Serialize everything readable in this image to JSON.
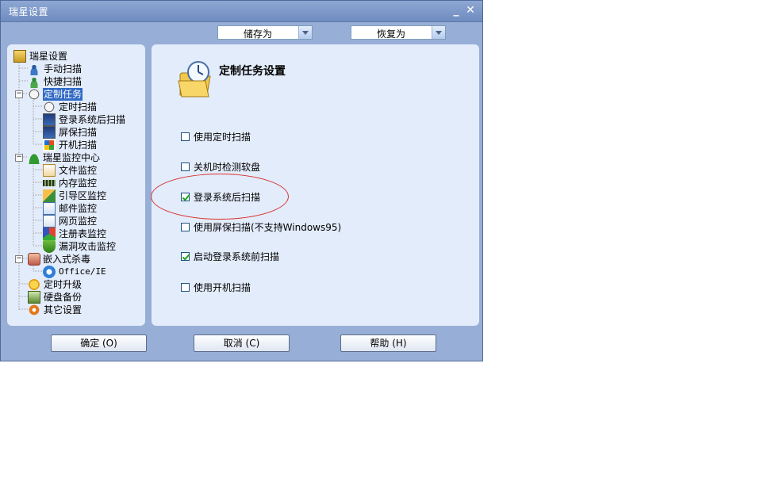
{
  "window": {
    "title": "瑞星设置",
    "minimize_glyph": "_",
    "close_glyph": "✕"
  },
  "toolbar": {
    "save_as": "储存为",
    "restore_as": "恢复为"
  },
  "tree": {
    "root": "瑞星设置",
    "manual_scan": "手动扫描",
    "quick_scan": "快捷扫描",
    "scheduled_tasks": "定制任务",
    "timed_scan": "定时扫描",
    "login_scan": "登录系统后扫描",
    "screensaver_scan": "屏保扫描",
    "startup_scan": "开机扫描",
    "monitor_center": "瑞星监控中心",
    "file_monitor": "文件监控",
    "memory_monitor": "内存监控",
    "boot_sector_monitor": "引导区监控",
    "mail_monitor": "邮件监控",
    "web_monitor": "网页监控",
    "registry_monitor": "注册表监控",
    "vuln_attack_monitor": "漏洞攻击监控",
    "embedded_scan": "嵌入式杀毒",
    "office_ie": "Office/IE",
    "scheduled_upgrade": "定时升级",
    "disk_backup": "硬盘备份",
    "other_settings": "其它设置",
    "expanded_glyph": "−"
  },
  "main": {
    "title": "定制任务设置",
    "options": [
      {
        "label": "使用定时扫描",
        "checked": false
      },
      {
        "label": "关机时检测软盘",
        "checked": false
      },
      {
        "label": "登录系统后扫描",
        "checked": true
      },
      {
        "label": "使用屏保扫描(不支持Windows95)",
        "checked": false
      },
      {
        "label": "启动登录系统前扫描",
        "checked": true
      },
      {
        "label": "使用开机扫描",
        "checked": false
      }
    ]
  },
  "buttons": {
    "ok": "确定 (O)",
    "cancel": "取消 (C)",
    "help": "帮助 (H)"
  },
  "colors": {
    "window_bg": "#97aed6",
    "panel_bg": "#e3ecfb",
    "selection": "#316ac5",
    "highlight_ellipse": "#d83030"
  }
}
